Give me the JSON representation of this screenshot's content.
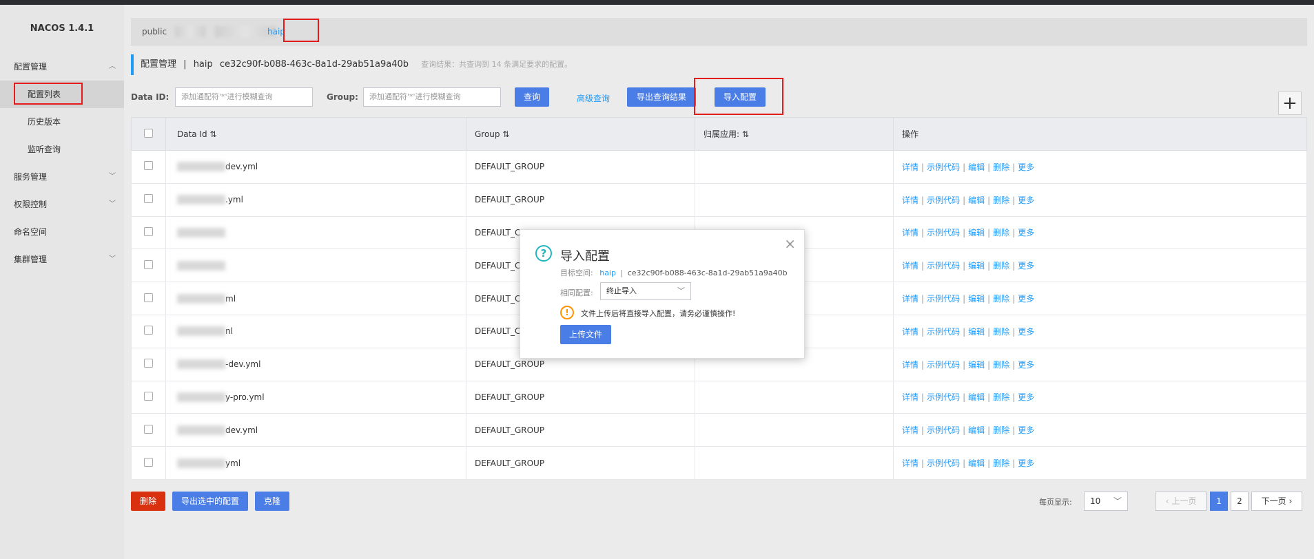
{
  "app": {
    "title": "NACOS 1.4.1"
  },
  "sidebar": {
    "items": [
      {
        "label": "配置管理",
        "expanded": true
      },
      {
        "label": "配置列表",
        "sub": true,
        "active": true
      },
      {
        "label": "历史版本",
        "sub": true
      },
      {
        "label": "监听查询",
        "sub": true
      },
      {
        "label": "服务管理",
        "expanded": false
      },
      {
        "label": "权限控制",
        "expanded": false
      },
      {
        "label": "命名空间"
      },
      {
        "label": "集群管理",
        "expanded": false
      }
    ]
  },
  "namespaces": {
    "public": "public",
    "active": "haip"
  },
  "header": {
    "title": "配置管理",
    "sep": "|",
    "ns_name": "haip",
    "ns_id": "ce32c90f-b088-463c-8a1d-29ab51a9a40b",
    "hint": "查询结果：共查询到 14 条满足要求的配置。"
  },
  "filters": {
    "dataid_label": "Data ID:",
    "dataid_placeholder": "添加通配符'*'进行模糊查询",
    "group_label": "Group:",
    "group_placeholder": "添加通配符'*'进行模糊查询",
    "query_btn": "查询",
    "advanced_link": "高级查询",
    "export_btn": "导出查询结果",
    "import_btn": "导入配置",
    "plus": "+"
  },
  "table": {
    "headers": [
      "Data Id",
      "Group",
      "归属应用:",
      "操作"
    ],
    "sort_icon": "⇅",
    "rows": [
      {
        "dataid": "dev.yml",
        "group": "DEFAULT_GROUP",
        "app": ""
      },
      {
        "dataid": ".yml",
        "group": "DEFAULT_GROUP",
        "app": ""
      },
      {
        "dataid": "",
        "group": "DEFAULT_C",
        "app": ""
      },
      {
        "dataid": "",
        "group": "DEFAULT_C",
        "app": ""
      },
      {
        "dataid": "ml",
        "group": "DEFAULT_C",
        "app": ""
      },
      {
        "dataid": "nl",
        "group": "DEFAULT_C",
        "app": ""
      },
      {
        "dataid": "-dev.yml",
        "group": "DEFAULT_GROUP",
        "app": ""
      },
      {
        "dataid": "y-pro.yml",
        "group": "DEFAULT_GROUP",
        "app": ""
      },
      {
        "dataid": "dev.yml",
        "group": "DEFAULT_GROUP",
        "app": ""
      },
      {
        "dataid": "yml",
        "group": "DEFAULT_GROUP",
        "app": ""
      }
    ],
    "ops": [
      "详情",
      "示例代码",
      "编辑",
      "删除",
      "更多"
    ]
  },
  "footer": {
    "delete_btn": "删除",
    "export_selected_btn": "导出选中的配置",
    "clone_btn": "克隆",
    "page_size_label": "每页显示:",
    "page_size": "10",
    "prev": "上一页",
    "pages": [
      "1",
      "2"
    ],
    "next": "下一页"
  },
  "modal": {
    "title": "导入配置",
    "target_label": "目标空间:",
    "target_ns": "haip",
    "target_sep": "|",
    "target_id": "ce32c90f-b088-463c-8a1d-29ab51a9a40b",
    "same_label": "相同配置:",
    "same_value": "终止导入",
    "warning": "文件上传后将直接导入配置，请务必谨慎操作!",
    "upload_btn": "上传文件",
    "close": "×"
  },
  "colors": {
    "primary": "#4a7ee6",
    "link": "#209bfa",
    "danger": "#d9300f",
    "highlight": "#e31b1b"
  }
}
